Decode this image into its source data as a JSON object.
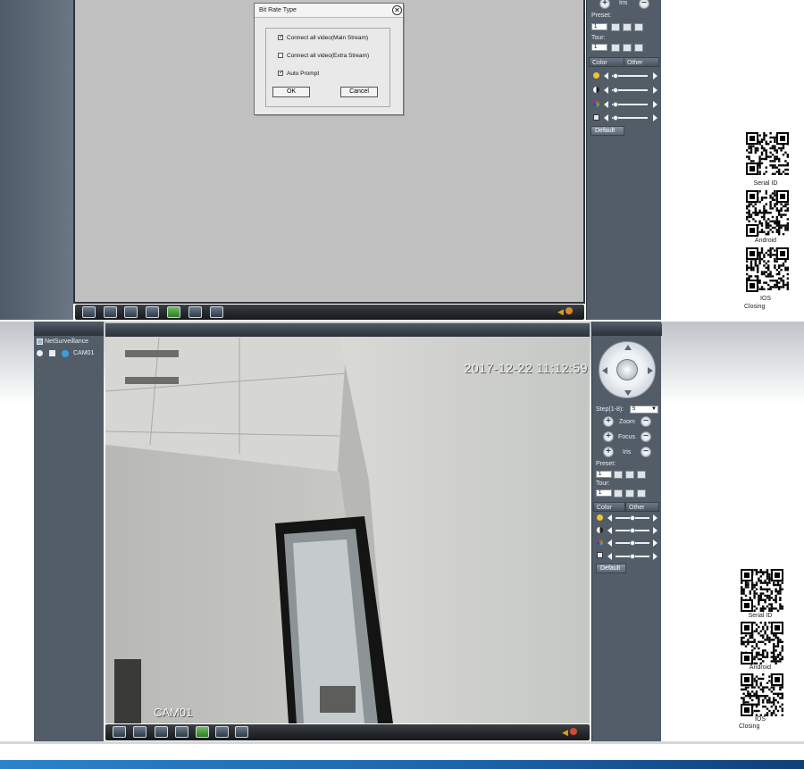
{
  "top": {
    "dialog": {
      "title": "Bit Rate Type",
      "options": [
        {
          "label": "Connect all video(Main Stream)",
          "checked": true
        },
        {
          "label": "Connect all video(Extra Stream)",
          "checked": false
        },
        {
          "label": "Auto Prompt",
          "checked": true
        }
      ],
      "ok_label": "OK",
      "cancel_label": "Cancel"
    },
    "panel": {
      "iris_label": "Iris",
      "preset_label": "Preset:",
      "preset_value": "1",
      "tour_label": "Tour:",
      "tour_value": "1",
      "tab_color": "Color",
      "tab_other": "Other",
      "default_label": "Default"
    },
    "qr_captions": [
      "Serial ID",
      "Android",
      "IOS"
    ],
    "closing_label": "Closing"
  },
  "bottom": {
    "tree": {
      "root_label": "NetSurveillance",
      "camera_label": "CAM01"
    },
    "video": {
      "timestamp": "2017-12-22 11:12:59",
      "camera_overlay": "CAM01"
    },
    "panel": {
      "step_label": "Step(1-8):",
      "step_value": "5",
      "zoom_label": "Zoom",
      "focus_label": "Focus",
      "iris_label": "Iris",
      "preset_label": "Preset:",
      "preset_value": "1",
      "tour_label": "Tour:",
      "tour_value": "1",
      "tab_color": "Color",
      "tab_other": "Other",
      "default_label": "Default"
    },
    "qr_captions": [
      "Serial ID",
      "Android",
      "IOS"
    ],
    "closing_label": "Closing"
  },
  "colors": {
    "panel_bg": "#525d68",
    "steel_dark": "#4e5b68",
    "video_bg": "#c0c0c0",
    "accent_blue": "#1b62a8"
  }
}
